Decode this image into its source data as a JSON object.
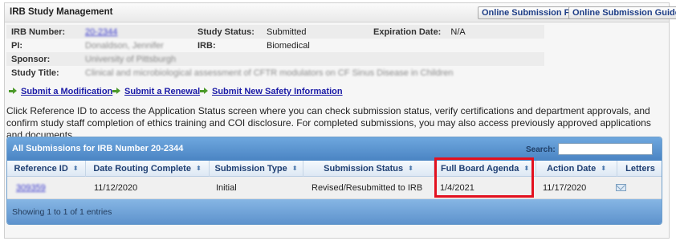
{
  "header": {
    "title": "IRB Study Management",
    "faq_label": "Online Submission FAQ",
    "guide_label": "Online Submission Guide"
  },
  "study": {
    "irb_number_label": "IRB Number:",
    "irb_number_value": "20-2344",
    "study_status_label": "Study Status:",
    "study_status_value": "Submitted",
    "expiration_label": "Expiration Date:",
    "expiration_value": "N/A",
    "pi_label": "PI:",
    "pi_value": "Donaldson, Jennifer",
    "irb_label": "IRB:",
    "irb_value": "Biomedical",
    "sponsor_label": "Sponsor:",
    "sponsor_value": "University of Pittsburgh",
    "title_label": "Study Title:",
    "title_value": "Clinical and microbiological assessment of CFTR modulators on CF Sinus Disease in Children"
  },
  "actions": {
    "modification": "Submit a Modification",
    "renewal": "Submit a Renewal",
    "safety": "Submit New Safety Information"
  },
  "description": "Click Reference ID to access the Application Status screen where you can check submission status, verify certifications and department approvals, and confirm study staff completion of ethics training and COI disclosure. For completed submissions, you may also access previously approved applications and documents.",
  "grid": {
    "caption": "All Submissions for IRB Number 20-2344",
    "search_label": "Search:",
    "search_value": "",
    "columns": [
      "Reference ID",
      "Date Routing Complete",
      "Submission Type",
      "Submission Status",
      "Full Board Agenda",
      "Action Date",
      "Letters"
    ],
    "sort_icon": "⬍",
    "rows": [
      {
        "reference_id": "309359",
        "date_routing_complete": "11/12/2020",
        "submission_type": "Initial",
        "submission_status": "Revised/Resubmitted to IRB",
        "full_board_agenda": "1/4/2021",
        "action_date": "11/17/2020"
      }
    ],
    "footer": "Showing 1 to 1 of 1 entries"
  },
  "colors": {
    "highlight": "#e3111f",
    "grid_header": "#4a84c3"
  }
}
